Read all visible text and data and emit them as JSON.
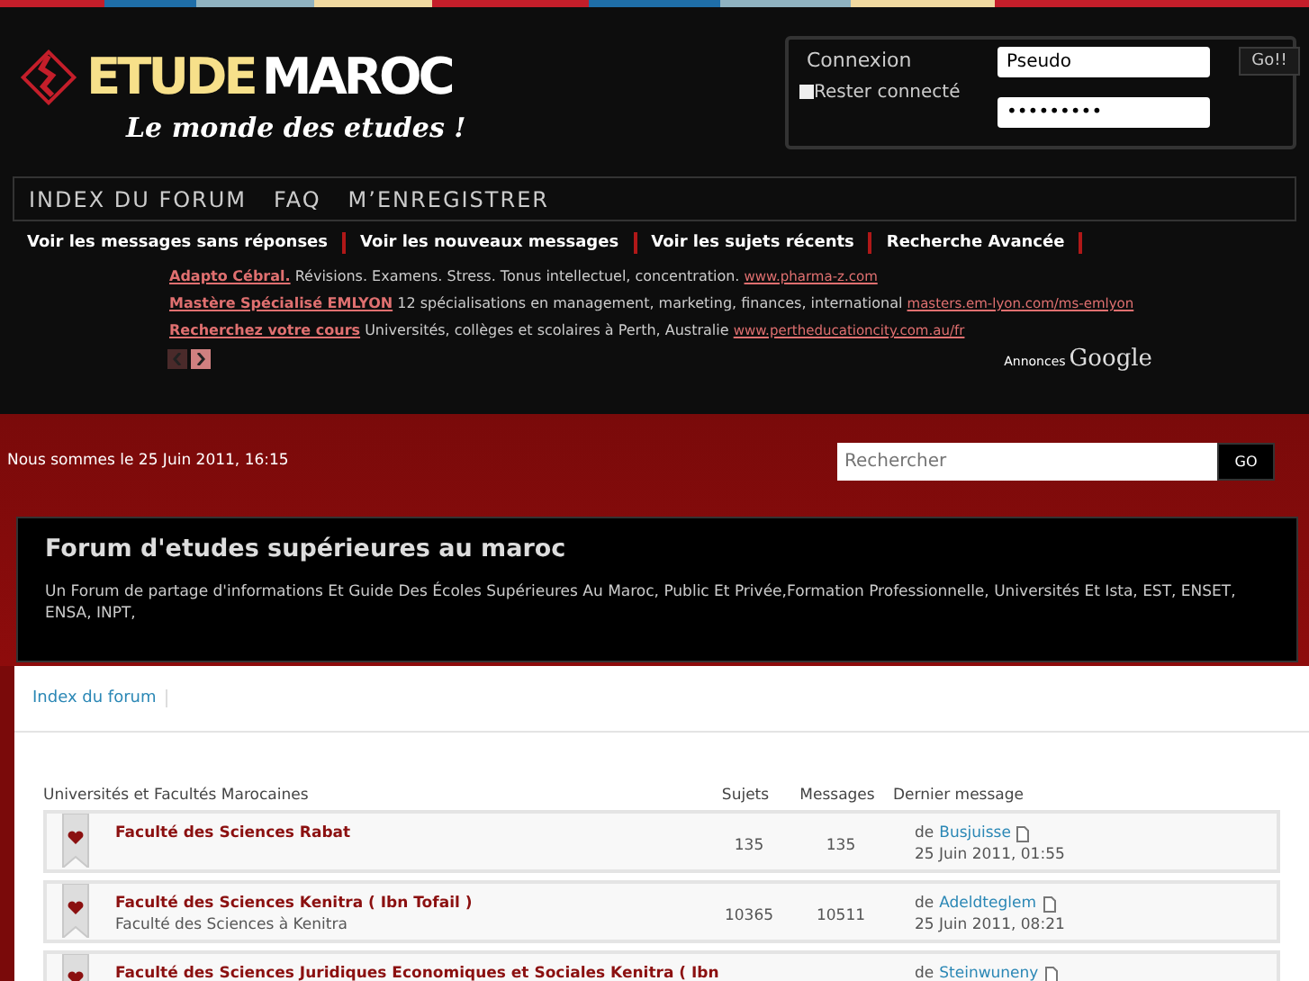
{
  "logo": {
    "name_part1": "ETUDE",
    "name_part2": "MAROC",
    "tagline": "Le monde des etudes !"
  },
  "login": {
    "title": "Connexion",
    "username": {
      "value": "Pseudo"
    },
    "password": {
      "value": "•••••••••"
    },
    "remember": {
      "label": "Rester connecté",
      "checked": false
    },
    "submit": "Go!!"
  },
  "main_nav": [
    "INDEX DU FORUM",
    "FAQ",
    "M’ENREGISTRER"
  ],
  "quick_links": [
    "Voir les messages sans réponses",
    "Voir les nouveaux messages",
    "Voir les sujets récents",
    "Recherche Avancée"
  ],
  "ads": [
    {
      "title": "Adapto Cébral.",
      "text": "Révisions. Examens. Stress. Tonus intellectuel, concentration.",
      "url": "www.pharma-z.com"
    },
    {
      "title": "Mastère Spécialisé EMLYON",
      "text": "12 spécialisations en management, marketing, finances, international",
      "url": "masters.em-lyon.com/ms-emlyon"
    },
    {
      "title": "Recherchez votre cours",
      "text": "Universités, collèges et scolaires à Perth, Australie",
      "url": "www.pertheducationcity.com.au/fr"
    }
  ],
  "ads_label": {
    "prefix": "Annonces",
    "brand": "Google"
  },
  "date": "Nous sommes le 25 Juin 2011, 16:15",
  "search": {
    "placeholder": "Rechercher",
    "button": "GO"
  },
  "site": {
    "title": "Forum d'etudes supérieures au maroc",
    "description": "Un Forum de partage d'informations Et Guide Des Écoles Supérieures Au Maroc, Public Et Privée,Formation Professionnelle, Universités Et Ista, EST, ENSET, ENSA, INPT,"
  },
  "breadcrumb": [
    "Index du forum"
  ],
  "forum_table": {
    "columns": [
      "Universités et Facultés Marocaines",
      "Sujets",
      "Messages",
      "Dernier message"
    ],
    "rows": [
      {
        "title": "Faculté des Sciences Rabat",
        "subtitle": "",
        "topics": "135",
        "posts": "135",
        "last_by": "de",
        "last_user": "Busjuisse",
        "last_date": "25 Juin 2011, 01:55"
      },
      {
        "title": "Faculté des Sciences Kenitra ( Ibn Tofail )",
        "subtitle": "Faculté des Sciences à Kenitra",
        "topics": "10365",
        "posts": "10511",
        "last_by": "de",
        "last_user": "Adeldteglem",
        "last_date": "25 Juin 2011, 08:21"
      },
      {
        "title": "Faculté des Sciences Juridiques Economiques et Sociales Kenitra ( Ibn",
        "subtitle": "",
        "topics": "",
        "posts": "",
        "last_by": "de",
        "last_user": "Steinwuneny",
        "last_date": ""
      }
    ]
  }
}
